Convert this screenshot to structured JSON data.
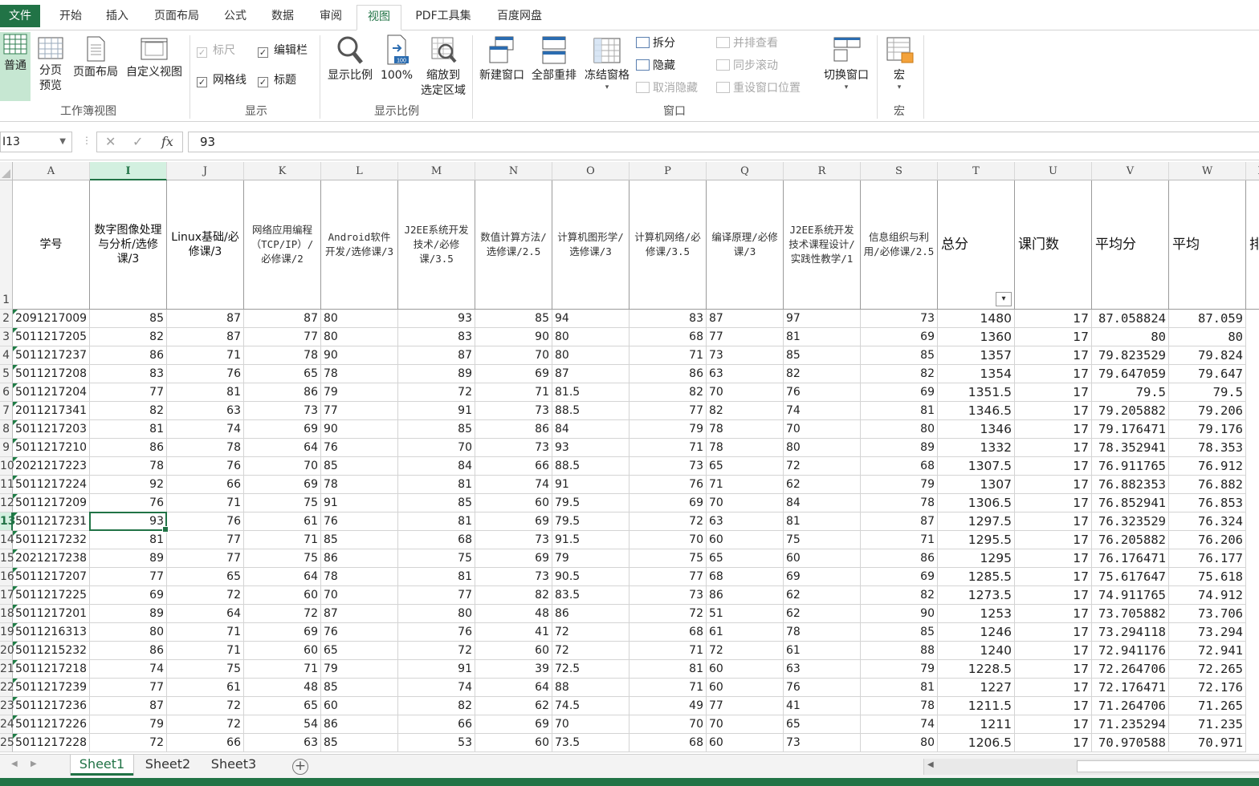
{
  "ribbon_tabs": [
    "文件",
    "开始",
    "插入",
    "页面布局",
    "公式",
    "数据",
    "审阅",
    "视图",
    "PDF工具集",
    "百度网盘"
  ],
  "active_tab": "视图",
  "ribbon": {
    "workbook_views": {
      "normal": "普通",
      "page_break": "分页\n预览",
      "page_layout": "页面布局",
      "custom": "自定义视图",
      "group_label": "工作簿视图"
    },
    "show": {
      "ruler": "标尺",
      "formula_bar": "编辑栏",
      "gridlines": "网格线",
      "headings": "标题",
      "group_label": "显示"
    },
    "zoom": {
      "zoom": "显示比例",
      "hundred": "100%",
      "to_selection": "缩放到\n选定区域",
      "group_label": "显示比例"
    },
    "window": {
      "new_window": "新建窗口",
      "arrange_all": "全部重排",
      "freeze": "冻结窗格",
      "split": "拆分",
      "hide": "隐藏",
      "unhide": "取消隐藏",
      "side_by_side": "并排查看",
      "sync_scroll": "同步滚动",
      "reset_pos": "重设窗口位置",
      "switch": "切换窗口",
      "group_label": "窗口"
    },
    "macros": {
      "macros": "宏",
      "group_label": "宏"
    }
  },
  "formula_bar": {
    "name_box": "I13",
    "value": "93"
  },
  "columns": [
    {
      "letter": "A",
      "header": "学号"
    },
    {
      "letter": "I",
      "header": "数字图像处理与分析/选修课/3"
    },
    {
      "letter": "J",
      "header": "Linux基础/必修课/3"
    },
    {
      "letter": "K",
      "header": "网络应用编程（TCP/IP）/必修课/2"
    },
    {
      "letter": "L",
      "header": "Android软件开发/选修课/3"
    },
    {
      "letter": "M",
      "header": "J2EE系统开发技术/必修课/3.5"
    },
    {
      "letter": "N",
      "header": "数值计算方法/选修课/2.5"
    },
    {
      "letter": "O",
      "header": "计算机图形学/选修课/3"
    },
    {
      "letter": "P",
      "header": "计算机网络/必修课/3.5"
    },
    {
      "letter": "Q",
      "header": "编译原理/必修课/3"
    },
    {
      "letter": "R",
      "header": "J2EE系统开发技术课程设计/实践性教学/1"
    },
    {
      "letter": "S",
      "header": "信息组织与利用/必修课/2.5"
    },
    {
      "letter": "T",
      "header": "总分"
    },
    {
      "letter": "U",
      "header": "课门数"
    },
    {
      "letter": "V",
      "header": "平均分"
    },
    {
      "letter": "W",
      "header": "平均"
    },
    {
      "letter": "X",
      "header": "排"
    }
  ],
  "row_numbers": [
    "1",
    "2",
    "3",
    "4",
    "5",
    "6",
    "7",
    "8",
    "9",
    "10",
    "11",
    "12",
    "13",
    "14",
    "15",
    "16",
    "17",
    "18",
    "19",
    "20",
    "21",
    "22",
    "23",
    "24",
    "25"
  ],
  "rows": [
    [
      "2091217009",
      "85",
      "87",
      "87",
      "80",
      "93",
      "85",
      "94",
      "83",
      "87",
      "97",
      "73",
      "1480",
      "17",
      "87.058824",
      "87.059"
    ],
    [
      "5011217205",
      "82",
      "87",
      "77",
      "80",
      "83",
      "90",
      "80",
      "68",
      "77",
      "81",
      "69",
      "1360",
      "17",
      "80",
      "80"
    ],
    [
      "5011217237",
      "86",
      "71",
      "78",
      "90",
      "87",
      "70",
      "80",
      "71",
      "73",
      "85",
      "85",
      "1357",
      "17",
      "79.823529",
      "79.824"
    ],
    [
      "5011217208",
      "83",
      "76",
      "65",
      "78",
      "89",
      "69",
      "87",
      "86",
      "63",
      "82",
      "82",
      "1354",
      "17",
      "79.647059",
      "79.647"
    ],
    [
      "5011217204",
      "77",
      "81",
      "86",
      "79",
      "72",
      "71",
      "81.5",
      "82",
      "70",
      "76",
      "69",
      "1351.5",
      "17",
      "79.5",
      "79.5"
    ],
    [
      "2011217341",
      "82",
      "63",
      "73",
      "77",
      "91",
      "73",
      "88.5",
      "77",
      "82",
      "74",
      "81",
      "1346.5",
      "17",
      "79.205882",
      "79.206"
    ],
    [
      "5011217203",
      "81",
      "74",
      "69",
      "90",
      "85",
      "86",
      "84",
      "79",
      "78",
      "70",
      "80",
      "1346",
      "17",
      "79.176471",
      "79.176"
    ],
    [
      "5011217210",
      "86",
      "78",
      "64",
      "76",
      "70",
      "73",
      "93",
      "71",
      "78",
      "80",
      "89",
      "1332",
      "17",
      "78.352941",
      "78.353"
    ],
    [
      "2021217223",
      "78",
      "76",
      "70",
      "85",
      "84",
      "66",
      "88.5",
      "73",
      "65",
      "72",
      "68",
      "1307.5",
      "17",
      "76.911765",
      "76.912"
    ],
    [
      "5011217224",
      "92",
      "66",
      "69",
      "78",
      "81",
      "74",
      "91",
      "76",
      "71",
      "62",
      "79",
      "1307",
      "17",
      "76.882353",
      "76.882"
    ],
    [
      "5011217209",
      "76",
      "71",
      "75",
      "91",
      "85",
      "60",
      "79.5",
      "69",
      "70",
      "84",
      "78",
      "1306.5",
      "17",
      "76.852941",
      "76.853"
    ],
    [
      "5011217231",
      "93",
      "76",
      "61",
      "76",
      "81",
      "69",
      "79.5",
      "72",
      "63",
      "81",
      "87",
      "1297.5",
      "17",
      "76.323529",
      "76.324"
    ],
    [
      "5011217232",
      "81",
      "77",
      "71",
      "85",
      "68",
      "73",
      "91.5",
      "70",
      "60",
      "75",
      "71",
      "1295.5",
      "17",
      "76.205882",
      "76.206"
    ],
    [
      "2021217238",
      "89",
      "77",
      "75",
      "86",
      "75",
      "69",
      "79",
      "75",
      "65",
      "60",
      "86",
      "1295",
      "17",
      "76.176471",
      "76.177"
    ],
    [
      "5011217207",
      "77",
      "65",
      "64",
      "78",
      "81",
      "73",
      "90.5",
      "77",
      "68",
      "69",
      "69",
      "1285.5",
      "17",
      "75.617647",
      "75.618"
    ],
    [
      "5011217225",
      "69",
      "72",
      "60",
      "70",
      "77",
      "82",
      "83.5",
      "73",
      "86",
      "62",
      "82",
      "1273.5",
      "17",
      "74.911765",
      "74.912"
    ],
    [
      "5011217201",
      "89",
      "64",
      "72",
      "87",
      "80",
      "48",
      "86",
      "72",
      "51",
      "62",
      "90",
      "1253",
      "17",
      "73.705882",
      "73.706"
    ],
    [
      "5011216313",
      "80",
      "71",
      "69",
      "76",
      "76",
      "41",
      "72",
      "68",
      "61",
      "78",
      "85",
      "1246",
      "17",
      "73.294118",
      "73.294"
    ],
    [
      "5011215232",
      "86",
      "71",
      "60",
      "65",
      "72",
      "60",
      "72",
      "71",
      "72",
      "61",
      "88",
      "1240",
      "17",
      "72.941176",
      "72.941"
    ],
    [
      "5011217218",
      "74",
      "75",
      "71",
      "79",
      "91",
      "39",
      "72.5",
      "81",
      "60",
      "63",
      "79",
      "1228.5",
      "17",
      "72.264706",
      "72.265"
    ],
    [
      "5011217239",
      "77",
      "61",
      "48",
      "85",
      "74",
      "64",
      "88",
      "71",
      "60",
      "76",
      "81",
      "1227",
      "17",
      "72.176471",
      "72.176"
    ],
    [
      "5011217236",
      "87",
      "72",
      "65",
      "60",
      "82",
      "62",
      "74.5",
      "49",
      "77",
      "41",
      "78",
      "1211.5",
      "17",
      "71.264706",
      "71.265"
    ],
    [
      "5011217226",
      "79",
      "72",
      "54",
      "86",
      "66",
      "69",
      "70",
      "70",
      "70",
      "65",
      "74",
      "1211",
      "17",
      "71.235294",
      "71.235"
    ],
    [
      "5011217228",
      "72",
      "66",
      "63",
      "85",
      "53",
      "60",
      "73.5",
      "68",
      "60",
      "73",
      "80",
      "1206.5",
      "17",
      "70.970588",
      "70.971"
    ]
  ],
  "sheets": [
    "Sheet1",
    "Sheet2",
    "Sheet3"
  ],
  "active_sheet": "Sheet1",
  "colors": {
    "accent": "#217346"
  }
}
